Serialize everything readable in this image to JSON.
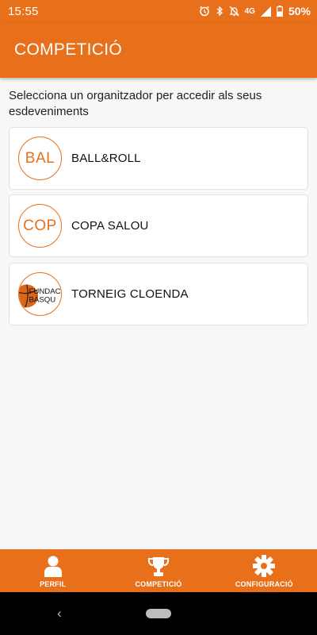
{
  "status_bar": {
    "time": "15:55",
    "network": "4G",
    "battery": "50%",
    "icons": [
      "alarm-icon",
      "bluetooth-icon",
      "notifications-off-icon",
      "signal-icon",
      "battery-icon"
    ]
  },
  "header": {
    "title": "COMPETICIÓ"
  },
  "main": {
    "intro": "Selecciona un organitzador per accedir als seus esdeveniments",
    "organizers": [
      {
        "abbr": "BAL",
        "name": "BALL&ROLL"
      },
      {
        "abbr": "COP",
        "name": "COPA SALOU"
      },
      {
        "abbr": "",
        "logo_text": [
          "FUNDAC",
          "BÀSQU"
        ],
        "name": "TORNEIG CLOENDA"
      }
    ]
  },
  "bottom_nav": {
    "items": [
      {
        "label": "PERFIL",
        "icon": "person-icon"
      },
      {
        "label": "COMPETICIÓ",
        "icon": "trophy-icon"
      },
      {
        "label": "CONFIGURACIÓ",
        "icon": "gear-icon"
      }
    ]
  },
  "system_nav": {
    "back": "‹"
  },
  "colors": {
    "accent": "#e8701a",
    "background": "#f7f7f7",
    "card": "#ffffff"
  }
}
